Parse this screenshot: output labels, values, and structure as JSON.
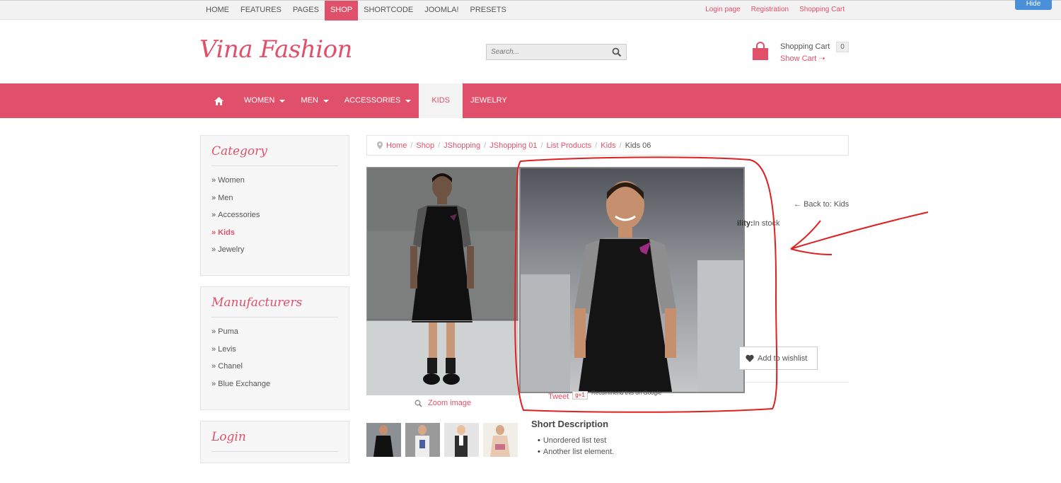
{
  "top_nav": {
    "items": [
      {
        "label": "HOME"
      },
      {
        "label": "FEATURES"
      },
      {
        "label": "PAGES"
      },
      {
        "label": "SHOP",
        "active": true
      },
      {
        "label": "SHORTCODE"
      },
      {
        "label": "JOOMLA!"
      },
      {
        "label": "PRESETS"
      }
    ],
    "links": [
      "Login page",
      "Registration",
      "Shopping Cart"
    ],
    "hide_label": "Hide"
  },
  "header": {
    "logo": "Vina Fashion",
    "search_placeholder": "Search...",
    "cart_title": "Shopping Cart",
    "cart_count": "0",
    "show_cart": "Show Cart"
  },
  "main_nav": {
    "items": [
      {
        "label": "WOMEN",
        "dropdown": true
      },
      {
        "label": "MEN",
        "dropdown": true
      },
      {
        "label": "ACCESSORIES",
        "dropdown": true
      },
      {
        "label": "KIDS",
        "active": true
      },
      {
        "label": "JEWELRY"
      }
    ]
  },
  "sidebar": {
    "category": {
      "title": "Category",
      "items": [
        "Women",
        "Men",
        "Accessories",
        "Kids",
        "Jewelry"
      ],
      "active": "Kids"
    },
    "manufacturers": {
      "title": "Manufacturers",
      "items": [
        "Puma",
        "Levis",
        "Chanel",
        "Blue Exchange"
      ]
    },
    "login": {
      "title": "Login"
    }
  },
  "breadcrumb": {
    "items": [
      "Home",
      "Shop",
      "JShopping",
      "JShopping 01",
      "List Products",
      "Kids"
    ],
    "current": "Kids 06"
  },
  "product": {
    "zoom_label": "Zoom image",
    "back_link": "Back to: Kids",
    "availability_label": "ility:",
    "availability_value": "In stock",
    "wishlist_label": "Add to wishlist",
    "tweet_label": "Tweet",
    "gplus_label": "g+1",
    "recommend_text": "Recommend this on Google",
    "short_description_title": "Short Description",
    "short_description_items": [
      "Unordered list test",
      "Another list element."
    ]
  },
  "colors": {
    "accent": "#e0506a",
    "annotation": "#e02020"
  }
}
